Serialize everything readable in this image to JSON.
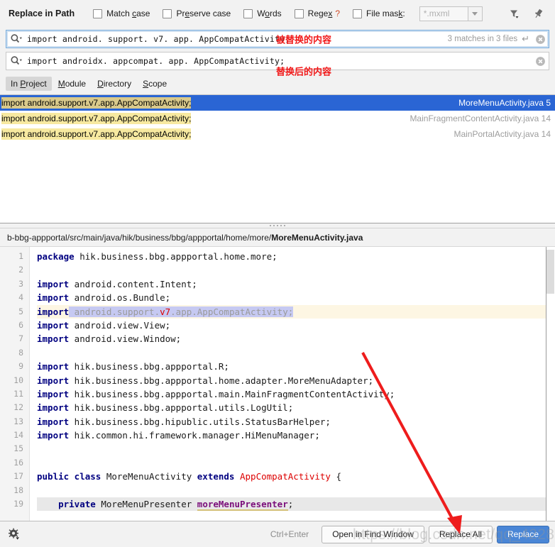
{
  "dialog": {
    "title": "Replace in Path"
  },
  "options": [
    {
      "label": "Match case",
      "mnemonic": "c",
      "checked": false,
      "name": "match-case"
    },
    {
      "label": "Preserve case",
      "mnemonic": "e",
      "checked": false,
      "name": "preserve-case"
    },
    {
      "label": "Words",
      "mnemonic": "o",
      "checked": false,
      "name": "words"
    },
    {
      "label": "Regex",
      "mnemonic": "x",
      "checked": false,
      "name": "regex",
      "help": "?"
    },
    {
      "label": "File mask:",
      "mnemonic": "k",
      "checked": false,
      "name": "file-mask"
    }
  ],
  "file_mask": {
    "value": "*.mxml",
    "enabled": false
  },
  "top_icons": {
    "filter": "filter-icon",
    "pin": "pin-icon"
  },
  "search": {
    "value": "import android. support. v7. app. AppCompatActivity;",
    "annotation": "被替换的内容",
    "match_info": "3 matches in 3 files",
    "enter_glyph": "↵",
    "icon": "search-icon"
  },
  "replace": {
    "value": "import androidx. appcompat. app. AppCompatActivity;",
    "annotation": "替换后的内容",
    "icon": "search-icon"
  },
  "scope_tabs": [
    {
      "label": "In Project",
      "active": true
    },
    {
      "label": "Module",
      "active": false
    },
    {
      "label": "Directory",
      "active": false
    },
    {
      "label": "Scope",
      "active": false
    }
  ],
  "results": [
    {
      "match_text": "import android.support.v7.app.AppCompatActivity;",
      "file": "MoreMenuActivity.java",
      "line": "5",
      "selected": true
    },
    {
      "match_text": "import android.support.v7.app.AppCompatActivity;",
      "file": "MainFragmentContentActivity.java",
      "line": "14",
      "selected": false
    },
    {
      "match_text": "import android.support.v7.app.AppCompatActivity;",
      "file": "MainPortalActivity.java",
      "line": "14",
      "selected": false
    }
  ],
  "preview": {
    "path_prefix": "b-bbg-appportal/src/main/java/hik/business/bbg/appportal/home/more/",
    "path_file": "MoreMenuActivity.java",
    "line_numbers": [
      "1",
      "2",
      "3",
      "4",
      "5",
      "6",
      "7",
      "8",
      "9",
      "10",
      "11",
      "12",
      "13",
      "14",
      "15",
      "16",
      "17",
      "18",
      "19"
    ],
    "code": [
      "package hik.business.bbg.appportal.home.more;",
      "",
      "import android.content.Intent;",
      "import android.os.Bundle;",
      "import android.support.v7.app.AppCompatActivity;",
      "import android.view.View;",
      "import android.view.Window;",
      "",
      "import hik.business.bbg.appportal.R;",
      "import hik.business.bbg.appportal.home.adapter.MoreMenuAdapter;",
      "import hik.business.bbg.appportal.main.MainFragmentContentActivity;",
      "import hik.business.bbg.appportal.utils.LogUtil;",
      "import hik.business.bbg.hipublic.utils.StatusBarHelper;",
      "import hik.common.hi.framework.manager.HiMenuManager;",
      "",
      "",
      "public class MoreMenuActivity extends AppCompatActivity {",
      "",
      "    private MoreMenuPresenter moreMenuPresenter;"
    ]
  },
  "bottom": {
    "gear_icon": "gear-icon",
    "shortcut": "Ctrl+Enter",
    "open_in_find_window": "Open in Find Window",
    "replace_all": "Replace All",
    "replace": "Replace"
  },
  "watermark": {
    "text": "https://blog.csdn.net/qq_42281792"
  },
  "colors": {
    "selection_blue": "#2a65d4",
    "match_yellow": "#f7e9a0",
    "annotation_red": "#f11818",
    "primary_button": "#4a86d6",
    "arrow_red": "#ee1c1c"
  }
}
